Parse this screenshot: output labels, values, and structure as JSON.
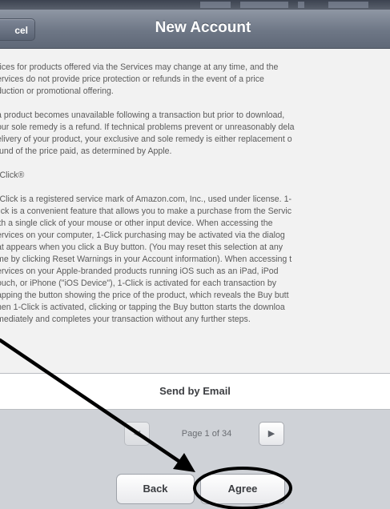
{
  "navbar": {
    "title": "New Account",
    "cancel_label": "cel"
  },
  "terms": {
    "paragraphs": [
      "rices for products offered via the Services may change at any time, and the\nervices do not provide price protection or refunds in the event of a price\nduction or promotional offering.",
      "a product becomes unavailable following a transaction but prior to download,\nour sole remedy is a refund. If technical problems prevent or unreasonably dela\nelivery of your product, your exclusive and sole remedy is either replacement o\nfund of the price paid, as determined by Apple.",
      "-Click®",
      "-Click is a registered service mark of Amazon.com, Inc., used under license. 1-\nlick is a convenient feature that allows you to make a purchase from the Servic\nith a single click of your mouse or other input device. When accessing the\nervices on your computer, 1-Click purchasing may be activated via the dialog\nat appears when you click a Buy button. (You may reset this selection at any\nme by clicking Reset Warnings in your Account information). When accessing t\nervices on your Apple-branded products running iOS such as an iPad, iPod\nouch, or iPhone (\"iOS Device\"), 1-Click is activated for each transaction by\napping the button showing the price of the product, which reveals the Buy butt\nhen 1-Click is activated, clicking or tapping the Buy button starts the downloa\nmediately and completes your transaction without any further steps."
    ]
  },
  "email": {
    "label": "Send by Email"
  },
  "pager": {
    "label": "Page 1 of 34",
    "prev_icon": "triangle-left-icon",
    "next_icon": "triangle-right-icon"
  },
  "actions": {
    "back_label": "Back",
    "agree_label": "Agree"
  },
  "colors": {
    "navbar": "#6e7786",
    "panel": "#f2f2f2",
    "annotation": "#000000"
  }
}
